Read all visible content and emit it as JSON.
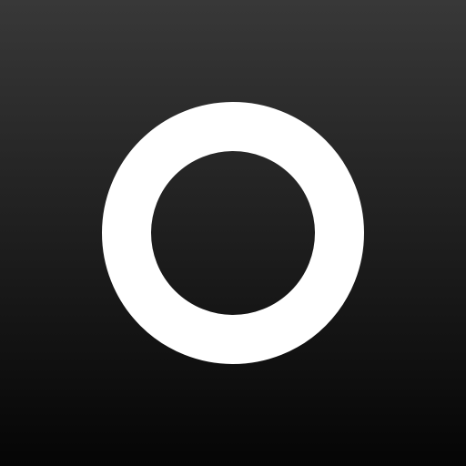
{
  "icon": {
    "name": "ring-icon",
    "background_top": "#383838",
    "background_bottom": "#050505",
    "ring_color": "#ffffff"
  }
}
